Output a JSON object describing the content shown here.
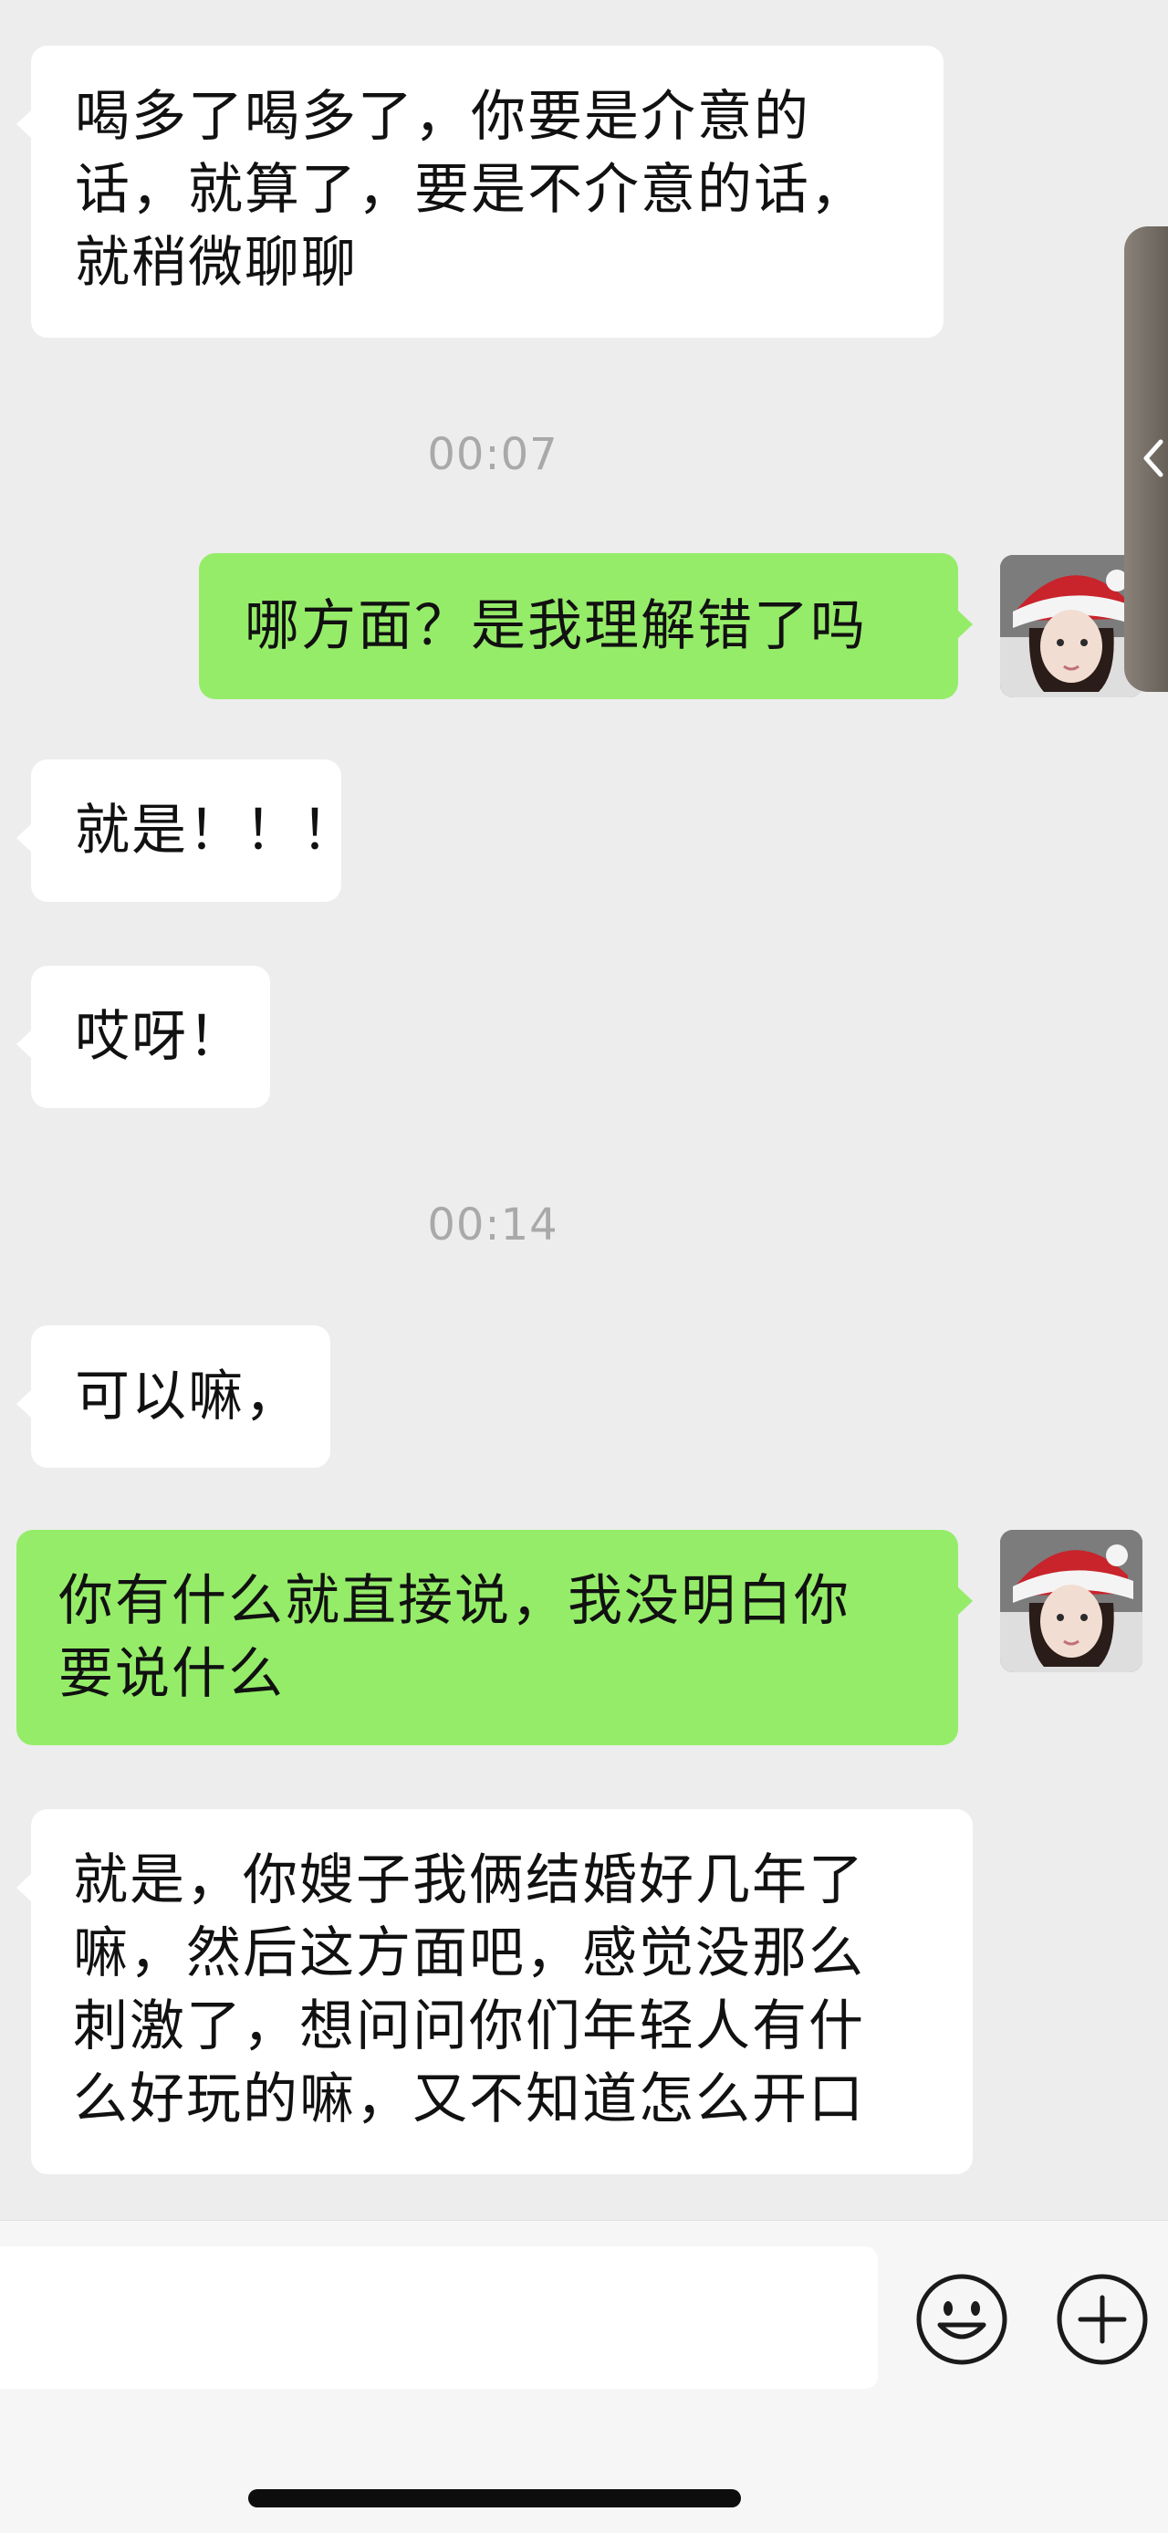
{
  "messages": {
    "m1": {
      "lines": [
        "喝多了喝多了，你要是介意的",
        "话，就算了，要是不介意的话，",
        "就稍微聊聊"
      ]
    },
    "t1": "00:07",
    "m2": {
      "lines": [
        "哪方面？是我理解错了吗"
      ]
    },
    "m3": {
      "lines": [
        "就是！！！"
      ]
    },
    "m4": {
      "lines": [
        "哎呀！"
      ]
    },
    "t2": "00:14",
    "m5": {
      "lines": [
        "可以嘛，"
      ]
    },
    "m6": {
      "lines": [
        "你有什么就直接说，我没明白你",
        "要说什么"
      ]
    },
    "m7": {
      "lines": [
        "就是，你嫂子我俩结婚好几年了",
        "嘛，然后这方面吧，感觉没那么",
        "刺激了，想问问你们年轻人有什",
        "么好玩的嘛，又不知道怎么开口"
      ]
    }
  },
  "composer": {
    "value": "",
    "emoji_icon": "smiley-face-icon",
    "plus_icon": "plus-circle-icon"
  },
  "colors": {
    "background": "#ededed",
    "outgoing_bubble": "#95ec69",
    "incoming_bubble": "#ffffff",
    "timestamp": "#a9a9a9"
  }
}
